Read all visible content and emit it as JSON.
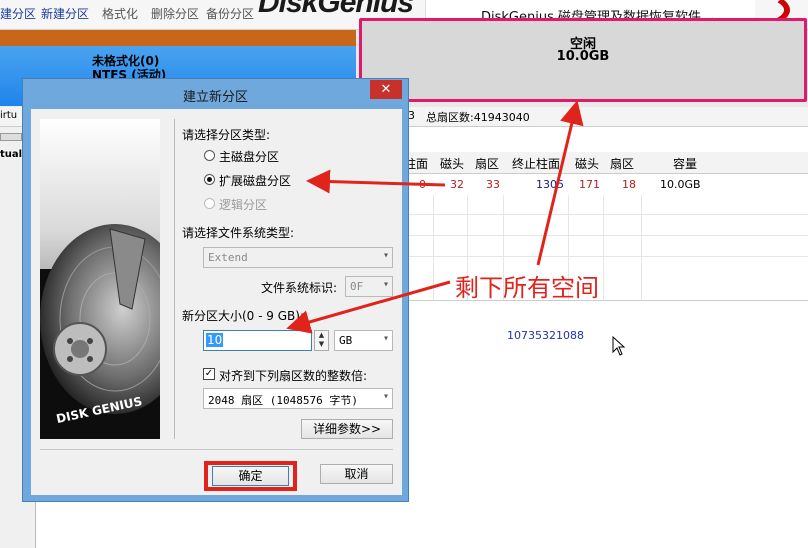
{
  "toolbar": {
    "buttons": [
      "建分区",
      "新建分区",
      "格式化",
      "删除分区",
      "备份分区"
    ],
    "logo_text": "DiskGenius",
    "app_title": "DiskGenius 磁盘管理及数据恢复软件"
  },
  "disk_map": {
    "left_partition": {
      "line1": "未格式化(0)",
      "line2": "NTFS (活动)"
    },
    "free_space": {
      "line1": "空闲",
      "line2": "10.0GB"
    }
  },
  "infobar": {
    "left": "3",
    "total_sectors": "总扇区数:41943040"
  },
  "left_tree": {
    "t1": "irtu",
    "t2": "tual"
  },
  "table": {
    "headers": [
      "柱面",
      "磁头",
      "扇区",
      "终止柱面",
      "磁头",
      "扇区",
      "容量"
    ],
    "row": [
      "0",
      "32",
      "33",
      "1305",
      "171",
      "18",
      "10.0GB"
    ]
  },
  "lower_panel": {
    "sector_number": "10735321088"
  },
  "annotation": {
    "text": "剩下所有空间"
  },
  "dialog": {
    "title": "建立新分区",
    "close_label": "✕",
    "partition_type_label": "请选择分区类型:",
    "options": {
      "primary": "主磁盘分区",
      "extended": "扩展磁盘分区",
      "logical": "逻辑分区"
    },
    "fs_type_label": "请选择文件系统类型:",
    "fs_type_value": "Extend",
    "fs_id_label": "文件系统标识:",
    "fs_id_value": "0F",
    "size_label": "新分区大小(0 - 9 GB):",
    "size_value": "10",
    "size_unit": "GB",
    "align_label": "对齐到下列扇区数的整数倍:",
    "align_value": "2048 扇区 (1048576 字节)",
    "details_button": "详细参数>>",
    "ok_button": "确定",
    "cancel_button": "取消",
    "image_caption": "DISK GENIUS"
  }
}
